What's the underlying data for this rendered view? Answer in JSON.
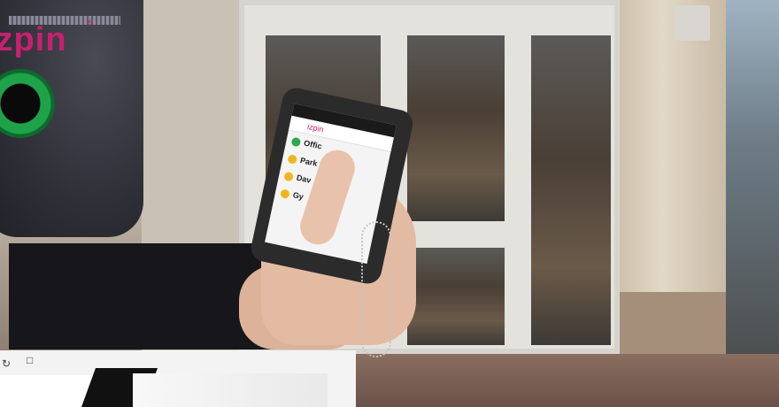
{
  "reader": {
    "brand": "izpin",
    "trademark": "®"
  },
  "phone": {
    "app_logo": "izpin",
    "rows": [
      {
        "label": "Offic",
        "status_color": "#2fa84f"
      },
      {
        "label": "Park",
        "status_color": "#f2b51c"
      },
      {
        "label": "Dav",
        "status_color": "#f2b51c"
      },
      {
        "label": "Gy",
        "status_color": "#f2b51c"
      }
    ]
  },
  "colors": {
    "brand_pink": "#c8206f",
    "reader_led": "#1fa34a"
  }
}
